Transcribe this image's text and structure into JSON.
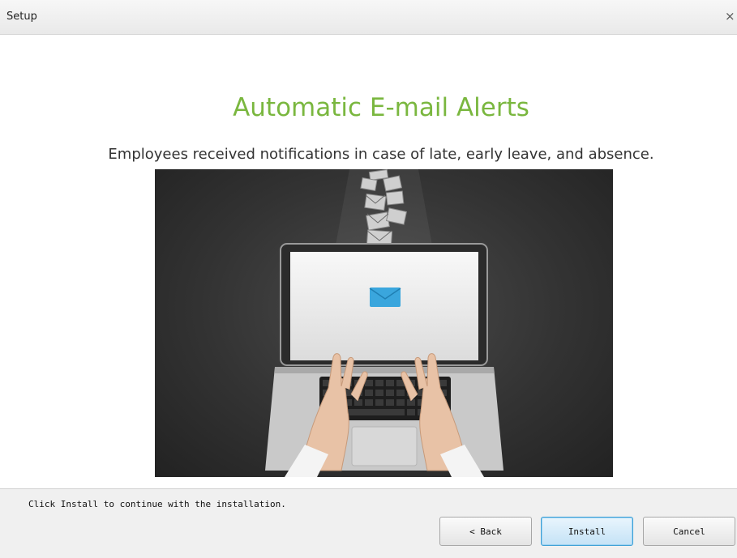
{
  "window": {
    "title": "Setup",
    "close_glyph": "×"
  },
  "content": {
    "heading": "Automatic E-mail Alerts",
    "subheading": "Employees received notifications in case of late, early leave, and absence.",
    "hero_image": {
      "icons": [
        "envelope-icon",
        "laptop-icon",
        "hands-typing"
      ]
    }
  },
  "footer": {
    "status": "Click Install to continue with the installation.",
    "back_label": "< Back",
    "install_label": "Install",
    "cancel_label": "Cancel"
  },
  "colors": {
    "heading": "#7ab73f",
    "install_border": "#3c9fd6",
    "envelope": "#3aa6dd"
  }
}
